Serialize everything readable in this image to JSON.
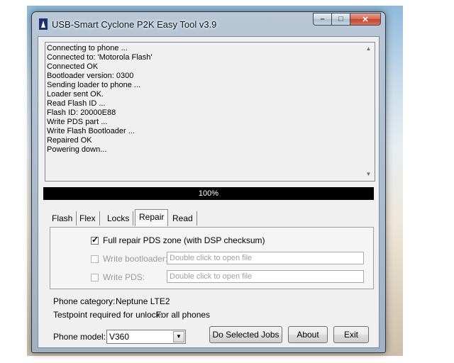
{
  "window": {
    "title": "USB-Smart Cyclone  P2K Easy Tool v3.9",
    "minimize_glyph": "–",
    "maximize_glyph": "□",
    "close_glyph": "✕"
  },
  "log": {
    "lines": [
      "Connecting to phone ...",
      "Connected to: 'Motorola Flash'",
      "Connected OK",
      "Bootloader version: 0300",
      "Sending loader to phone ...",
      "Loader sent OK.",
      "Read Flash ID ...",
      "Flash ID: 20000E88",
      "Write PDS part ...",
      "Write Flash Bootloader ...",
      "Repaired OK",
      "Powering down..."
    ]
  },
  "progress": {
    "value": 1.0,
    "label": "100%"
  },
  "tabs": [
    {
      "label": "Flash",
      "active": false
    },
    {
      "label": "Flex",
      "active": false
    },
    {
      "label": "Locks",
      "active": false
    },
    {
      "label": "Repair",
      "active": true
    },
    {
      "label": "Read",
      "active": false
    }
  ],
  "repair": {
    "full_repair": {
      "label": "Full repair PDS zone (with DSP checksum)",
      "checked": true
    },
    "write_bootloader": {
      "label": "Write bootloader:",
      "checked": false,
      "placeholder": "Double click to open file"
    },
    "write_pds": {
      "label": "Write PDS:",
      "checked": false,
      "placeholder": "Double click to open file"
    }
  },
  "info": {
    "phone_category_label": "Phone category:",
    "phone_category_value": "Neptune LTE2",
    "testpoint_label": "Testpoint required for unlock:",
    "testpoint_value": "For all phones"
  },
  "phone_model": {
    "label": "Phone model:",
    "value": "V360"
  },
  "buttons": {
    "do_jobs": "Do Selected Jobs",
    "about": "About",
    "exit": "Exit"
  },
  "icons": {
    "app": "cyclone-app-icon",
    "scroll_up": "▲",
    "scroll_down": "▼",
    "dropdown": "▼",
    "check": "✓"
  },
  "colors": {
    "progress_bar": "#000000",
    "close_button": "#c4442c"
  }
}
